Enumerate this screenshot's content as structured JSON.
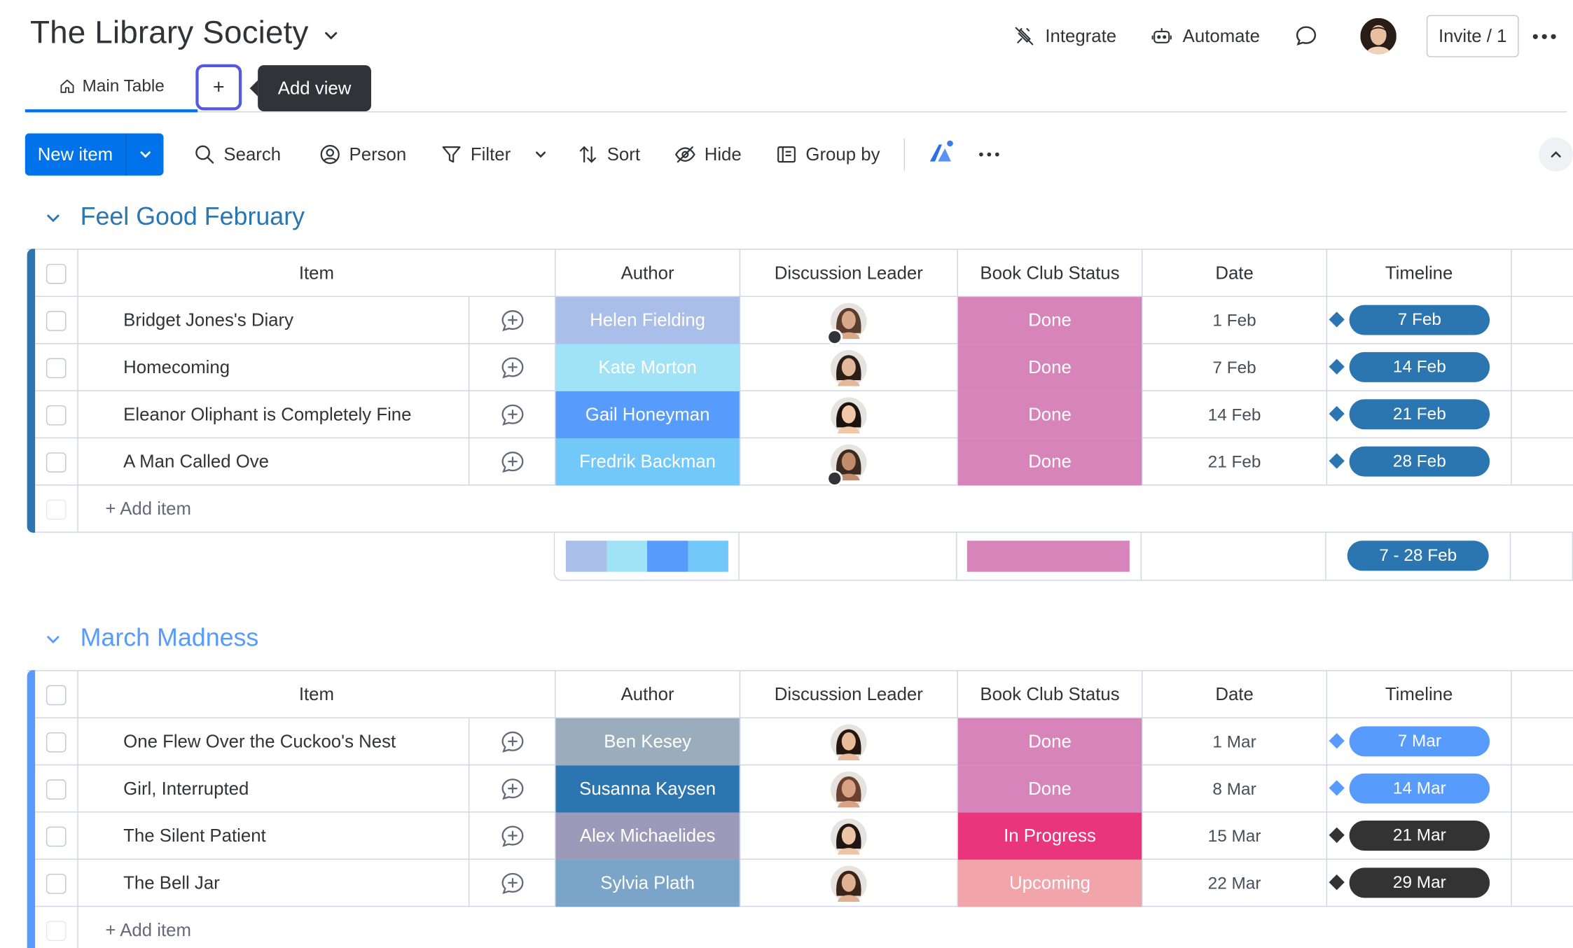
{
  "board": {
    "title": "The Library Society"
  },
  "header": {
    "integrate_label": "Integrate",
    "automate_label": "Automate",
    "invite_label": "Invite / 1"
  },
  "views": {
    "main_tab_label": "Main Table",
    "add_view_symbol": "+",
    "tooltip": "Add view"
  },
  "toolbar": {
    "new_item_label": "New item",
    "search_label": "Search",
    "person_label": "Person",
    "filter_label": "Filter",
    "sort_label": "Sort",
    "hide_label": "Hide",
    "group_by_label": "Group by"
  },
  "columns": {
    "item": "Item",
    "author": "Author",
    "discussion_leader": "Discussion Leader",
    "status": "Book Club Status",
    "date": "Date",
    "timeline": "Timeline"
  },
  "add_item_label": "+ Add item",
  "icons": {
    "integrate": "plug-icon",
    "automate": "robot-icon",
    "chat": "chat-bubble-icon",
    "home": "home-icon",
    "search": "search-icon",
    "person": "person-icon",
    "filter": "filter-icon",
    "sort": "sort-icon",
    "hide": "eye-off-icon",
    "group_by": "group-by-icon",
    "update": "add-update-icon"
  },
  "colors": {
    "primary": "#0073ea",
    "selected_tab_outline": "#5559df",
    "done": "#d784bb",
    "in_progress": "#e8357b",
    "upcoming": "#f1a4a9",
    "group1": "#2b76b1",
    "group2": "#579bfc"
  },
  "groups": [
    {
      "title": "Feel Good February",
      "color": "#2b76b1",
      "rows": [
        {
          "item": "Bridget Jones's Diary",
          "author": "Helen Fielding",
          "author_color": "#a9bee8",
          "status": "Done",
          "status_color": "#d784bb",
          "date": "1 Feb",
          "timeline": "7 Feb",
          "timeline_color": "#2b76b1",
          "leader_has_home": true
        },
        {
          "item": "Homecoming",
          "author": "Kate Morton",
          "author_color": "#a1e3f6",
          "status": "Done",
          "status_color": "#d784bb",
          "date": "7 Feb",
          "timeline": "14 Feb",
          "timeline_color": "#2b76b1",
          "leader_has_home": false
        },
        {
          "item": "Eleanor Oliphant is Completely Fine",
          "author": "Gail Honeyman",
          "author_color": "#579bfc",
          "status": "Done",
          "status_color": "#d784bb",
          "date": "14 Feb",
          "timeline": "21 Feb",
          "timeline_color": "#2b76b1",
          "leader_has_home": false
        },
        {
          "item": "A Man Called Ove",
          "author": "Fredrik Backman",
          "author_color": "#71c8f9",
          "status": "Done",
          "status_color": "#d784bb",
          "date": "21 Feb",
          "timeline": "28 Feb",
          "timeline_color": "#2b76b1",
          "leader_has_home": true
        }
      ],
      "summary_timeline": "7 - 28 Feb"
    },
    {
      "title": "March Madness",
      "color": "#579bfc",
      "rows": [
        {
          "item": "One Flew Over the Cuckoo's Nest",
          "author": "Ben Kesey",
          "author_color": "#9aadbd",
          "status": "Done",
          "status_color": "#d784bb",
          "date": "1 Mar",
          "timeline": "7 Mar",
          "timeline_color": "#579bfc",
          "leader_has_home": false
        },
        {
          "item": "Girl, Interrupted",
          "author": "Susanna Kaysen",
          "author_color": "#2b76b1",
          "status": "Done",
          "status_color": "#d784bb",
          "date": "8 Mar",
          "timeline": "14 Mar",
          "timeline_color": "#579bfc",
          "leader_has_home": false
        },
        {
          "item": "The Silent Patient",
          "author": "Alex Michaelides",
          "author_color": "#9d99b9",
          "status": "In Progress",
          "status_color": "#e8357b",
          "date": "15 Mar",
          "timeline": "21 Mar",
          "timeline_color": "#333333",
          "leader_has_home": false
        },
        {
          "item": "The Bell Jar",
          "author": "Sylvia Plath",
          "author_color": "#7aa5c8",
          "status": "Upcoming",
          "status_color": "#f1a4a9",
          "date": "22 Mar",
          "timeline": "29 Mar",
          "timeline_color": "#333333",
          "leader_has_home": false
        }
      ]
    }
  ]
}
